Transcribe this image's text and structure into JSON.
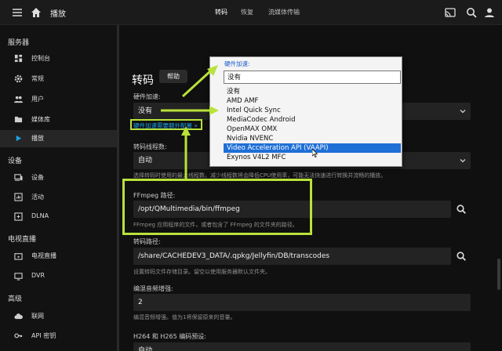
{
  "header": {
    "page_title": "播放",
    "tabs": [
      {
        "label": "转码",
        "active": true
      },
      {
        "label": "恢复",
        "active": false
      },
      {
        "label": "流媒体传输",
        "active": false
      }
    ],
    "icons": [
      "menu-icon",
      "home-icon",
      "cast-icon",
      "search-icon",
      "account-icon"
    ]
  },
  "sidebar": {
    "sections": [
      {
        "title": "服务器",
        "items": [
          {
            "label": "控制台",
            "icon": "dashboard-icon"
          },
          {
            "label": "常规",
            "icon": "settings-icon"
          },
          {
            "label": "用户",
            "icon": "people-icon"
          },
          {
            "label": "媒体库",
            "icon": "folder-icon"
          },
          {
            "label": "播放",
            "icon": "play-icon",
            "active": true
          }
        ]
      },
      {
        "title": "设备",
        "items": [
          {
            "label": "设备",
            "icon": "devices-icon"
          },
          {
            "label": "活动",
            "icon": "assessment-icon"
          },
          {
            "label": "DLNA",
            "icon": "settings-input-icon"
          }
        ]
      },
      {
        "title": "电视直播",
        "items": [
          {
            "label": "电视直播",
            "icon": "live-tv-icon"
          },
          {
            "label": "DVR",
            "icon": "dvr-icon"
          }
        ]
      },
      {
        "title": "高级",
        "items": [
          {
            "label": "联网",
            "icon": "cloud-icon"
          },
          {
            "label": "API 密钥",
            "icon": "vpn-key-icon"
          }
        ]
      }
    ]
  },
  "main": {
    "title": "转码",
    "help_label": "帮助",
    "hw_accel": {
      "label": "硬件加速:",
      "value": "没有",
      "link": "硬件加速需要额外配置 »"
    },
    "threads": {
      "label": "转码线程数:",
      "value": "自动",
      "hint": "选择转码时使用的最大线程数。减少线程数将会降低CPU使用率，可能无法快速进行转换并流畅的播放。"
    },
    "ffmpeg": {
      "label": "FFmpeg 路径:",
      "value": "/opt/QMultimedia/bin/ffmpeg",
      "hint": "FFmpeg 应用程序的文件，或者包含了 FFmpeg 的文件夹的路径。"
    },
    "transcode_path": {
      "label": "转码路径:",
      "value": "/share/CACHEDEV3_DATA/.qpkg/Jellyfin/DB/transcodes",
      "hint": "设置转码文件存储目录。留空以使用服务器默认文件夹。"
    },
    "audio_boost": {
      "label": "编混音频增强:",
      "value": "2",
      "hint": "编混音频增强。值为1将保留原来的音量。"
    },
    "h264_preset": {
      "label": "H264 和 H265 编码预设:",
      "value": "自动"
    }
  },
  "dropdown": {
    "legend": "硬件加速:",
    "current": "没有",
    "options": [
      {
        "label": "没有",
        "selected": false
      },
      {
        "label": "AMD AMF",
        "selected": false
      },
      {
        "label": "Intel Quick Sync",
        "selected": false
      },
      {
        "label": "MediaCodec Android",
        "selected": false
      },
      {
        "label": "OpenMAX OMX",
        "selected": false
      },
      {
        "label": "Nvidia NVENC",
        "selected": false
      },
      {
        "label": "Video Acceleration API (VAAPI)",
        "selected": true
      },
      {
        "label": "Exynos V4L2 MFC",
        "selected": false
      }
    ]
  },
  "colors": {
    "accent": "#19a2e6",
    "annotation": "#b9e23a",
    "selected": "#1e6fd6"
  }
}
